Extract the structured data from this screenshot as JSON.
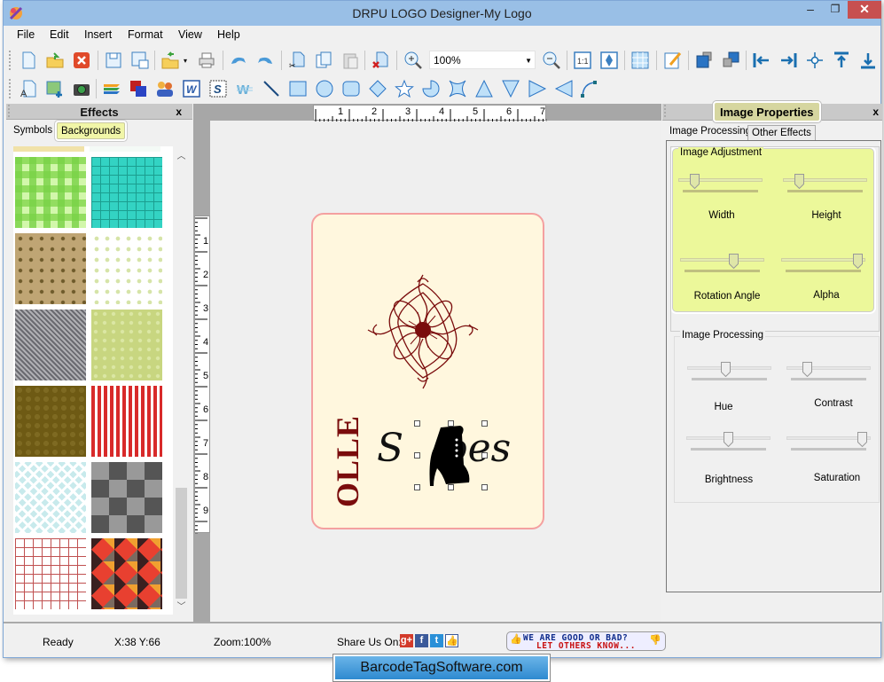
{
  "window": {
    "title": "DRPU LOGO Designer-My Logo",
    "controls": {
      "minimize": "–",
      "maximize": "❐",
      "close": "✕"
    }
  },
  "menu": [
    "File",
    "Edit",
    "Insert",
    "Format",
    "View",
    "Help"
  ],
  "toolbar1": {
    "zoom_value": "100%",
    "icons": [
      "new-icon",
      "open-icon",
      "close-doc-icon",
      "save-icon",
      "save-as-icon",
      "import-icon",
      "print-icon",
      "undo-icon",
      "redo-icon",
      "cut-icon",
      "copy-icon",
      "paste-icon",
      "delete-icon",
      "zoom-in-icon",
      "zoom-out-icon",
      "actual-size-icon",
      "fit-to-window-icon",
      "grid-icon",
      "edit-properties-icon",
      "bring-forward-icon",
      "send-backward-icon",
      "align-left-icon",
      "align-right-icon",
      "align-center-icon",
      "align-top-icon",
      "align-bottom-icon"
    ]
  },
  "toolbar2": {
    "icons": [
      "text-icon",
      "image-icon",
      "camera-icon",
      "layers-icon",
      "background-icon",
      "symbols-icon",
      "word-art-icon",
      "signature-icon",
      "watermark-icon",
      "line-icon",
      "rectangle-icon",
      "ellipse-icon",
      "rounded-rectangle-icon",
      "diamond-icon",
      "star-icon",
      "pie-icon",
      "cross-shape-icon",
      "triangle-up-icon",
      "triangle-down-icon",
      "triangle-right-icon",
      "triangle-left-icon",
      "arc-icon"
    ]
  },
  "effects_panel": {
    "title": "Effects",
    "close": "x",
    "tabs": [
      {
        "label": "Symbols",
        "active": false
      },
      {
        "label": "Backgrounds",
        "active": true
      }
    ],
    "swatches": [
      "green-gingham",
      "teal-grid",
      "tan-tile",
      "cream-dots",
      "gray-weave",
      "olive-cross",
      "brown-hex",
      "red-stripes",
      "aqua-chevron",
      "gray-squares",
      "red-grid",
      "argyle"
    ]
  },
  "canvas": {
    "hruler_labels": [
      "1",
      "2",
      "3",
      "4",
      "5",
      "6",
      "7"
    ],
    "vruler_labels": [
      "1",
      "2",
      "3",
      "4",
      "5",
      "6",
      "7",
      "8",
      "9"
    ],
    "logo": {
      "vertical_text": "OLLE",
      "script_text_left": "S",
      "script_text_right": "oes",
      "accent_color": "#7a0c0c",
      "border_color": "#f4a0a0",
      "background_color": "#fff7de"
    }
  },
  "image_properties": {
    "title": "Image Properties",
    "close": "x",
    "tabs": [
      {
        "label": "Image Processing",
        "active": true
      },
      {
        "label": "Other Effects",
        "active": false
      }
    ],
    "adjustment_group": {
      "label": "Image Adjustment",
      "sliders": [
        {
          "label": "Width",
          "value": 0.15
        },
        {
          "label": "Height",
          "value": 0.15
        },
        {
          "label": "Rotation Angle",
          "value": 0.65
        },
        {
          "label": "Alpha",
          "value": 0.97
        }
      ]
    },
    "processing_group": {
      "label": "Image Processing",
      "sliders": [
        {
          "label": "Hue",
          "value": 0.45
        },
        {
          "label": "Contrast",
          "value": 0.22
        },
        {
          "label": "Brightness",
          "value": 0.5
        },
        {
          "label": "Saturation",
          "value": 0.95
        }
      ]
    }
  },
  "status": {
    "state": "Ready",
    "coords": "X:38  Y:66",
    "zoom": "Zoom:100%",
    "share_label": "Share Us On:",
    "social": [
      "google-plus",
      "facebook",
      "twitter",
      "like"
    ],
    "review_line1": "WE ARE GOOD OR BAD?",
    "review_line2": "LET OTHERS KNOW..."
  },
  "footer": {
    "link": "BarcodeTagSoftware.com"
  }
}
